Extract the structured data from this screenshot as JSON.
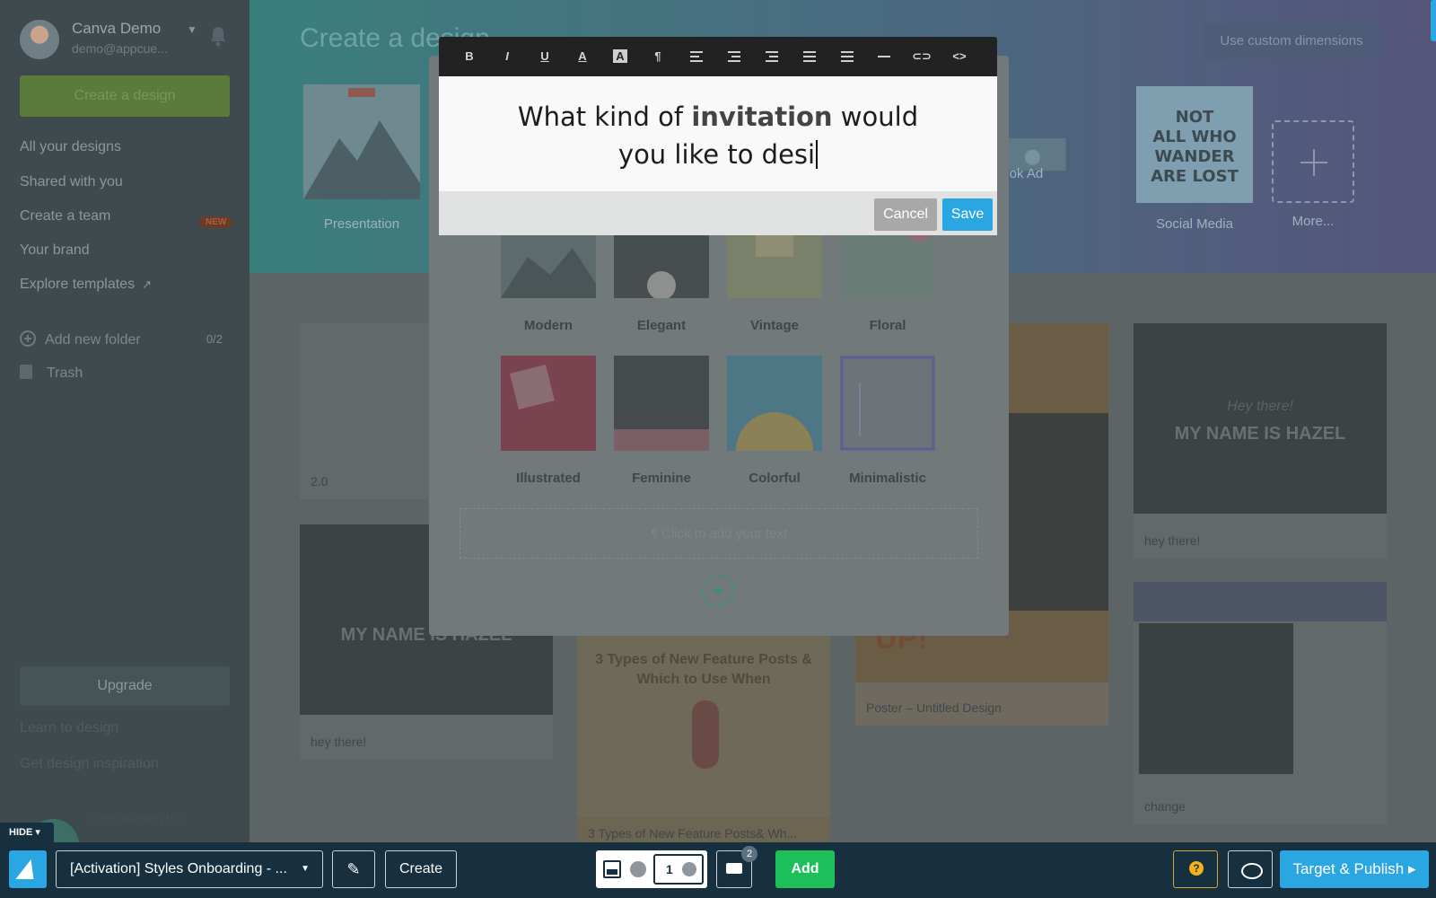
{
  "sidebar": {
    "user_name": "Canva Demo",
    "user_email": "demo@appcue...",
    "create_button": "Create a design",
    "nav": [
      {
        "label": "All your designs"
      },
      {
        "label": "Shared with you"
      },
      {
        "label": "Create a team",
        "badge": "NEW"
      },
      {
        "label": "Your brand"
      },
      {
        "label": "Explore templates"
      }
    ],
    "add_folder": "Add new folder",
    "folder_count": "0/2",
    "trash": "Trash",
    "upgrade": "Upgrade",
    "learn": "Learn to design",
    "inspiration": "Get design inspiration",
    "footer_text": "Empowering the"
  },
  "hero": {
    "title": "Create a design",
    "custom_dimensions": "Use custom dimensions",
    "tiles": [
      {
        "label": "Presentation"
      },
      {
        "label": "acebook Ad"
      },
      {
        "label": "Social Media"
      },
      {
        "label": "More..."
      }
    ]
  },
  "cards": {
    "c1": "2.0",
    "c2": "hey there!",
    "c3": "3 Types of New Feature Posts& Wh...",
    "c4": "Poster – Untitled Design",
    "c5": "hey there!",
    "c6": "change"
  },
  "card_texts": {
    "hazel": "MY NAME IS HAZEL",
    "hey": "Hey there!",
    "feature": "3 Types of New Feature Posts & Which to Use When",
    "poster_a": "UP!"
  },
  "modal": {
    "styles": [
      {
        "label": "Modern"
      },
      {
        "label": "Elegant"
      },
      {
        "label": "Vintage"
      },
      {
        "label": "Floral"
      },
      {
        "label": "Illustrated"
      },
      {
        "label": "Feminine"
      },
      {
        "label": "Colorful"
      },
      {
        "label": "Minimalistic"
      }
    ],
    "text_placeholder": "¶ Click to add your text"
  },
  "editor": {
    "line1_pre": "What kind of ",
    "line1_bold": "invitation",
    "line1_post": " would",
    "line2": "you like to desi",
    "cancel": "Cancel",
    "save": "Save"
  },
  "builder": {
    "hide": "HIDE",
    "flow_name": "[Activation] Styles Onboarding - ...",
    "create": "Create",
    "step_number": "1",
    "hotspot_count": "2",
    "add": "Add",
    "target_publish": "Target & Publish"
  },
  "colors": {
    "accent_blue": "#2aa7e3",
    "add_green": "#1dbf5b",
    "help_yellow": "#f2b31b",
    "builder_bg": "#16303f"
  }
}
